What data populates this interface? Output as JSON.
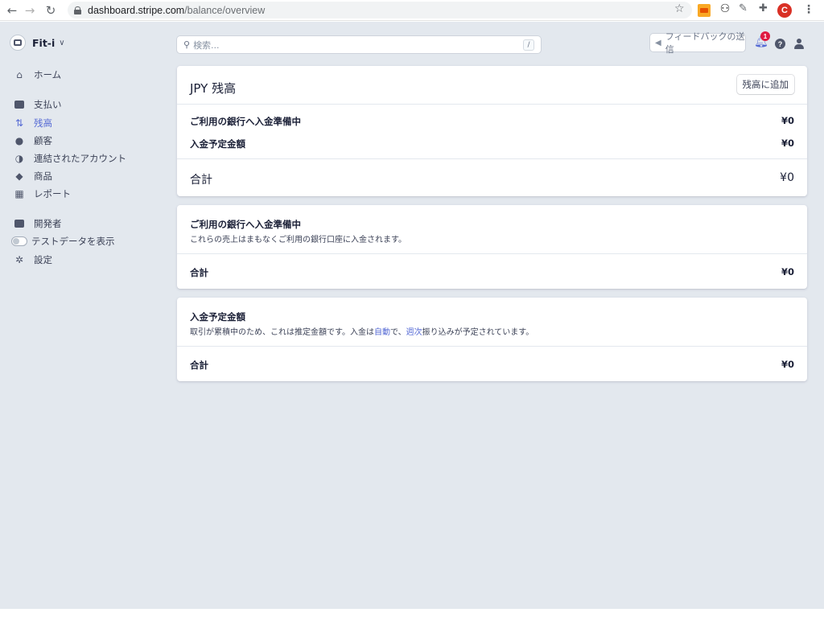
{
  "browser": {
    "url_host": "dashboard.stripe.com",
    "url_path": "/balance/overview",
    "profile_initial": "C"
  },
  "sidebar": {
    "account_name": "Fit-i",
    "items": [
      {
        "label": "ホーム",
        "icon": "home-icon"
      },
      {
        "label": "支払い",
        "icon": "payments-icon"
      },
      {
        "label": "残高",
        "icon": "balance-icon",
        "active": true
      },
      {
        "label": "顧客",
        "icon": "customers-icon"
      },
      {
        "label": "連結されたアカウント",
        "icon": "connected-accounts-icon"
      },
      {
        "label": "商品",
        "icon": "products-icon"
      },
      {
        "label": "レポート",
        "icon": "reports-icon"
      },
      {
        "label": "開発者",
        "icon": "developers-icon"
      },
      {
        "label": "テストデータを表示",
        "icon": "toggle"
      },
      {
        "label": "設定",
        "icon": "settings-icon"
      }
    ]
  },
  "header": {
    "search_placeholder": "検索...",
    "search_shortcut": "/",
    "feedback_label": "フィードバックの送信",
    "notification_count": "1"
  },
  "balance_card": {
    "title": "JPY 残高",
    "add_button": "残高に追加",
    "rows": [
      {
        "label": "ご利用の銀行へ入金準備中",
        "value": "¥0"
      },
      {
        "label": "入金予定金額",
        "value": "¥0"
      }
    ],
    "total_label": "合計",
    "total_value": "¥0"
  },
  "pending_card": {
    "title": "ご利用の銀行へ入金準備中",
    "description": "これらの売上はまもなくご利用の銀行口座に入金されます。",
    "total_label": "合計",
    "total_value": "¥0"
  },
  "expected_card": {
    "title": "入金予定金額",
    "desc_prefix": "取引が累積中のため、これは推定金額です。入金は",
    "desc_link1": "自動",
    "desc_mid": "で、",
    "desc_link2": "週次",
    "desc_suffix": "振り込みが予定されています。",
    "total_label": "合計",
    "total_value": "¥0"
  },
  "colors": {
    "accent": "#5469d4",
    "background": "#e3e8ee",
    "badge": "#df1b41"
  }
}
